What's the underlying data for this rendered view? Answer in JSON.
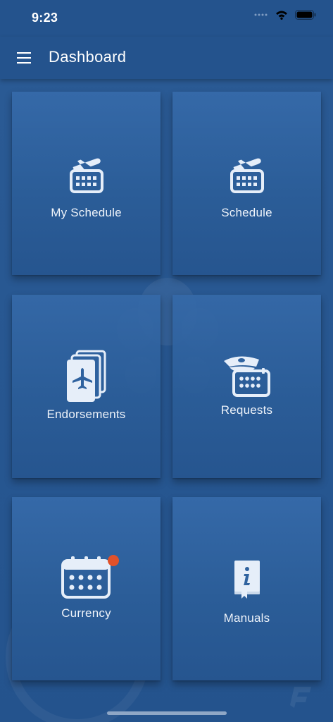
{
  "status_bar": {
    "time": "9:23"
  },
  "header": {
    "title": "Dashboard"
  },
  "tiles": [
    {
      "label": "My Schedule",
      "icon": "plane-calendar-icon"
    },
    {
      "label": "Schedule",
      "icon": "plane-calendar-icon"
    },
    {
      "label": "Endorsements",
      "icon": "plane-cards-icon"
    },
    {
      "label": "Requests",
      "icon": "pilot-cap-calendar-icon"
    },
    {
      "label": "Currency",
      "icon": "calendar-icon",
      "badge": true
    },
    {
      "label": "Manuals",
      "icon": "info-book-icon"
    }
  ],
  "colors": {
    "background": "#24538d",
    "tile": "#2f629f",
    "badge": "#e0512a"
  }
}
